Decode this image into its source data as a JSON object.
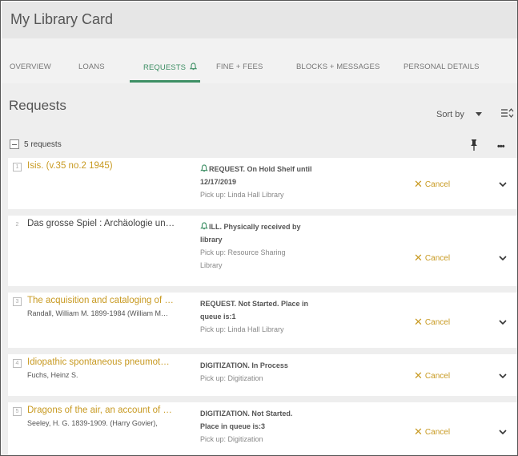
{
  "header": {
    "title": "My Library Card"
  },
  "tabs": [
    {
      "label": "OVERVIEW"
    },
    {
      "label": "LOANS"
    },
    {
      "label": "REQUESTS"
    },
    {
      "label": "FINE + FEES"
    },
    {
      "label": "BLOCKS + MESSAGES"
    },
    {
      "label": "PERSONAL DETAILS"
    }
  ],
  "requests": {
    "heading": "Requests",
    "sort_label": "Sort by",
    "count_label": "5 requests",
    "items": [
      {
        "index": "1",
        "title": "Isis. (v.35 no.2 1945)",
        "author": "",
        "status_line1": "REQUEST. On Hold Shelf until",
        "status_line2": "12/17/2019",
        "status_line3": "Pick up: Linda Hall Library",
        "status_line4": "",
        "cancel_label": "Cancel"
      },
      {
        "index": "2",
        "title": "Das grosse Spiel : Archäologie un…",
        "author": "",
        "status_line1": "ILL. Physically received by",
        "status_line2": "library",
        "status_line3": "Pick up: Resource Sharing",
        "status_line4": "Library",
        "cancel_label": "Cancel"
      },
      {
        "index": "3",
        "title": "The acquisition and cataloging of …",
        "author": "Randall, William M. 1899-1984 (William M…",
        "status_line1": "REQUEST. Not Started. Place in",
        "status_line2": "queue is:1",
        "status_line3": "Pick up: Linda Hall Library",
        "status_line4": "",
        "cancel_label": "Cancel"
      },
      {
        "index": "4",
        "title": "Idiopathic spontaneous pneumot…",
        "author": "Fuchs, Heinz S.",
        "status_line1": "DIGITIZATION. In Process",
        "status_line2": "Pick up: Digitization",
        "status_line3": "",
        "status_line4": "",
        "cancel_label": "Cancel"
      },
      {
        "index": "5",
        "title": "Dragons of the air, an account of …",
        "author": "Seeley, H. G. 1839-1909. (Harry Govier),",
        "status_line1": "DIGITIZATION. Not Started.",
        "status_line2": "Place in queue is:3",
        "status_line3": "Pick up: Digitization",
        "status_line4": "",
        "cancel_label": "Cancel"
      }
    ]
  },
  "colors": {
    "accent_green": "#3d8f64",
    "title_gold": "#c89a22",
    "header_bg": "#e6e6e6",
    "panel_bg": "#eeeeee"
  },
  "icons": [
    "bell-icon",
    "sort-icon",
    "pin-icon",
    "more-icon",
    "close-icon",
    "chevron-down-icon",
    "collapse-icon"
  ]
}
